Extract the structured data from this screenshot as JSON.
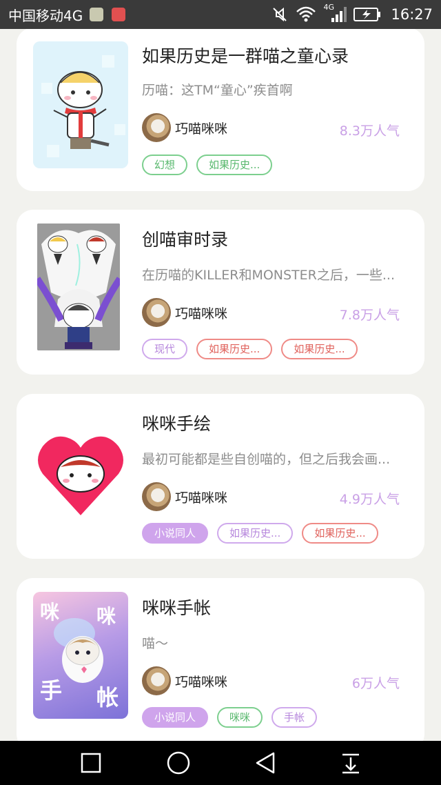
{
  "status_bar": {
    "carrier": "中国移动4G",
    "network_badge": "4G",
    "time": "16:27",
    "icons": [
      "app-icon-photos",
      "app-icon-mail",
      "mute-icon",
      "wifi-icon",
      "signal-icon",
      "battery-charging-icon"
    ]
  },
  "cards": [
    {
      "title": "如果历史是一群喵之童心录",
      "desc": "历喵：这TM“童心”疾首啊",
      "author": "巧喵咪咪",
      "popularity": "8.3万人气",
      "tags": [
        {
          "label": "幻想",
          "style": "green"
        },
        {
          "label": "如果历史...",
          "style": "green"
        }
      ]
    },
    {
      "title": "创喵审时录",
      "desc": "在历喵的KILLER和MONSTER之后，一些...",
      "author": "巧喵咪咪",
      "popularity": "7.8万人气",
      "tags": [
        {
          "label": "现代",
          "style": "purple"
        },
        {
          "label": "如果历史...",
          "style": "red"
        },
        {
          "label": "如果历史...",
          "style": "red"
        }
      ]
    },
    {
      "title": "咪咪手绘",
      "desc": "最初可能都是些自创喵的，但之后我会画...",
      "author": "巧喵咪咪",
      "popularity": "4.9万人气",
      "tags": [
        {
          "label": "小说同人",
          "style": "filled"
        },
        {
          "label": "如果历史...",
          "style": "purple"
        },
        {
          "label": "如果历史...",
          "style": "red"
        }
      ]
    },
    {
      "title": "咪咪手帐",
      "desc": "喵～",
      "author": "巧喵咪咪",
      "popularity": "6万人气",
      "cover_text": [
        "咪",
        "咪",
        "手",
        "帐"
      ],
      "tags": [
        {
          "label": "小说同人",
          "style": "filled"
        },
        {
          "label": "咪咪",
          "style": "green"
        },
        {
          "label": "手帐",
          "style": "purple"
        }
      ]
    }
  ],
  "nav_bar": {
    "buttons": [
      "recent-apps-icon",
      "home-icon",
      "back-icon",
      "notification-pulldown-icon"
    ]
  },
  "colors": {
    "background": "#f2f2ee",
    "popularity": "#c9a0e6",
    "tag_green": "#7ccf8e",
    "tag_purple": "#cfa9ec",
    "tag_red": "#ef8a86"
  }
}
